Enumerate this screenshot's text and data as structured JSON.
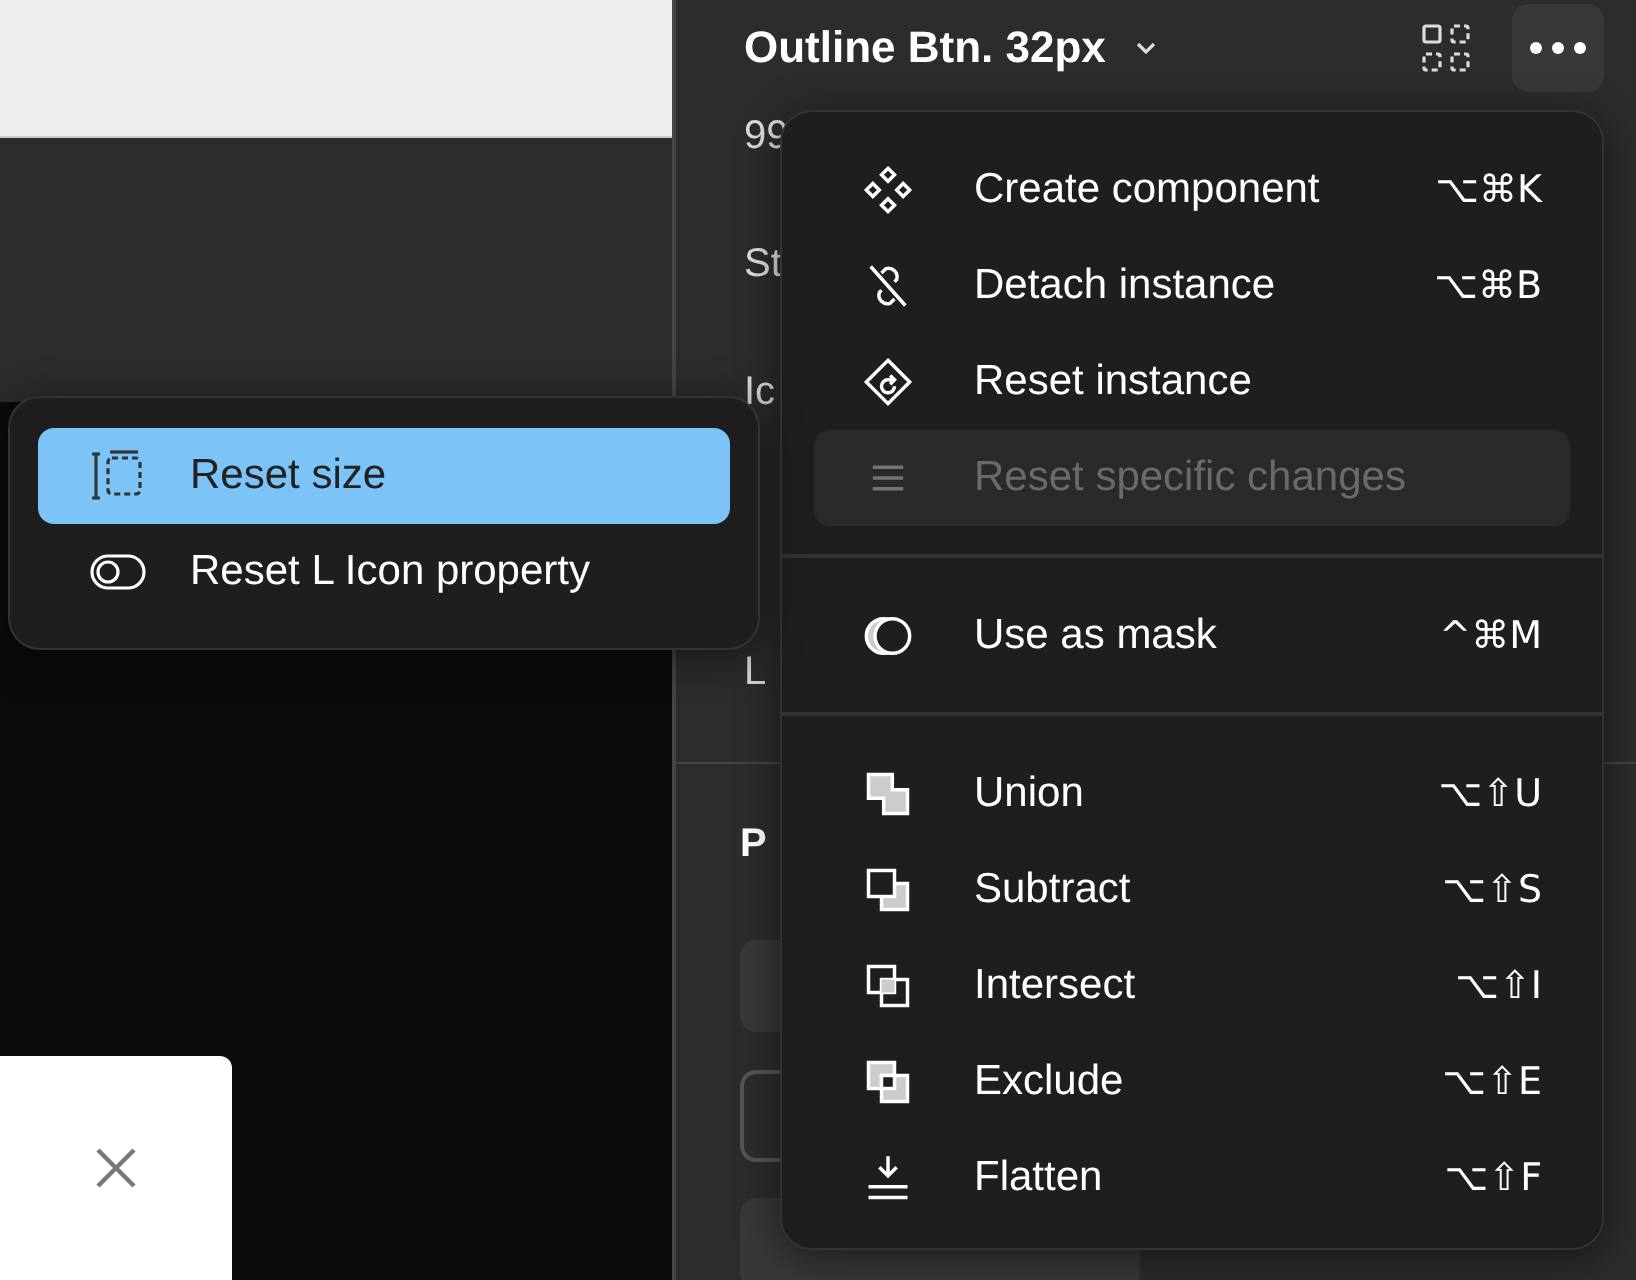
{
  "panel": {
    "title": "Outline Btn. 32px",
    "labels": [
      "99",
      "St",
      "Ic",
      "L"
    ],
    "section_label": "P"
  },
  "context_menu": {
    "items": [
      {
        "kind": "item",
        "label": "Create component",
        "shortcut": "⌥⌘K",
        "disabled": false,
        "selected": false
      },
      {
        "kind": "item",
        "label": "Detach instance",
        "shortcut": "⌥⌘B",
        "disabled": false,
        "selected": false
      },
      {
        "kind": "item",
        "label": "Reset instance",
        "disabled": false,
        "selected": false
      },
      {
        "kind": "item",
        "label": "Reset specific changes",
        "disabled": true,
        "selected": true
      },
      {
        "kind": "separator"
      },
      {
        "kind": "item",
        "label": "Use as mask",
        "shortcut": "^⌘M",
        "disabled": false,
        "selected": false
      },
      {
        "kind": "separator"
      },
      {
        "kind": "item",
        "label": "Union",
        "shortcut": "⌥⇧U",
        "disabled": false,
        "selected": false
      },
      {
        "kind": "item",
        "label": "Subtract",
        "shortcut": "⌥⇧S",
        "disabled": false,
        "selected": false
      },
      {
        "kind": "item",
        "label": "Intersect",
        "shortcut": "⌥⇧I",
        "disabled": false,
        "selected": false
      },
      {
        "kind": "item",
        "label": "Exclude",
        "shortcut": "⌥⇧E",
        "disabled": false,
        "selected": false
      },
      {
        "kind": "item",
        "label": "Flatten",
        "shortcut": "⌥⇧F",
        "disabled": false,
        "selected": false
      }
    ]
  },
  "submenu": {
    "items": [
      {
        "label": "Reset size",
        "selected": true
      },
      {
        "label": "Reset L Icon property",
        "selected": false
      }
    ]
  }
}
